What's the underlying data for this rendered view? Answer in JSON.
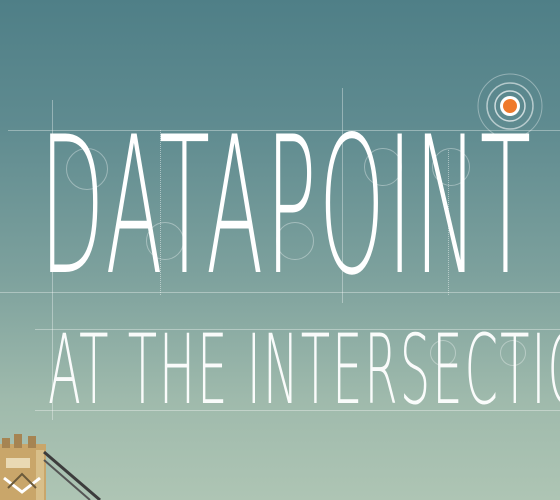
{
  "header": {
    "title": "DATAPOINT",
    "subtitle": "AT THE INTERSECTION"
  },
  "colors": {
    "accent": "#ef7a2c",
    "sky_top": "#4f7f87",
    "sky_bottom": "#aec5b4",
    "text": "#ffffff"
  },
  "icons": [
    "target-icon",
    "bridge-illustration"
  ]
}
